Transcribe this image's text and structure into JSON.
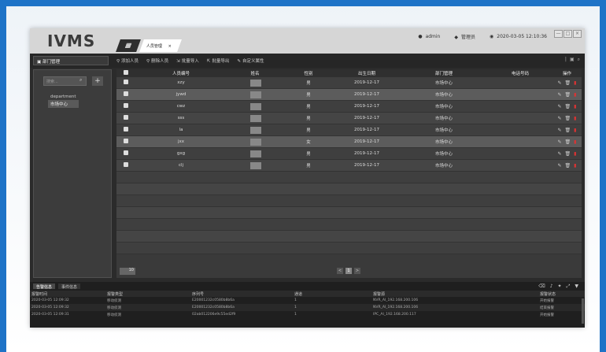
{
  "titlebar": {
    "logo": "IVMS",
    "home_tab_icon": "home-icon",
    "active_tab": "人员管理",
    "close_tab": "×",
    "user": "admin",
    "role": "管理员",
    "datetime": "2020-03-05 12:10:36",
    "window_buttons": [
      "—",
      "□",
      "×"
    ]
  },
  "toolbar": {
    "dept_title": "部门管理",
    "actions": [
      {
        "icon": "person-add-icon",
        "label": "添加人员"
      },
      {
        "icon": "person-remove-icon",
        "label": "删除人员"
      },
      {
        "icon": "import-icon",
        "label": "批量导入"
      },
      {
        "icon": "export-icon",
        "label": "批量导出"
      },
      {
        "icon": "edit-icon",
        "label": "自定义属性"
      }
    ]
  },
  "leftpanel": {
    "search_placeholder": "搜索...",
    "tree": [
      {
        "label": "department",
        "selected": false
      },
      {
        "label": "市场中心",
        "selected": true
      }
    ]
  },
  "table": {
    "headers": [
      "人员编号",
      "姓名",
      "性别",
      "出生日期",
      "部门管理",
      "电话号码",
      "操作"
    ],
    "rows": [
      {
        "id": "xzy",
        "name": "",
        "gender": "男",
        "birth": "2019-12-17",
        "dept": "市场中心",
        "phone": ""
      },
      {
        "id": "jywd",
        "name": "",
        "gender": "男",
        "birth": "2019-12-17",
        "dept": "市场中心",
        "phone": ""
      },
      {
        "id": "cwz",
        "name": "",
        "gender": "男",
        "birth": "2019-12-17",
        "dept": "市场中心",
        "phone": ""
      },
      {
        "id": "sss",
        "name": "",
        "gender": "男",
        "birth": "2019-12-17",
        "dept": "市场中心",
        "phone": ""
      },
      {
        "id": "la",
        "name": "",
        "gender": "男",
        "birth": "2019-12-17",
        "dept": "市场中心",
        "phone": ""
      },
      {
        "id": "jxx",
        "name": "",
        "gender": "女",
        "birth": "2019-12-17",
        "dept": "市场中心",
        "phone": ""
      },
      {
        "id": "gxg",
        "name": "",
        "gender": "男",
        "birth": "2019-12-17",
        "dept": "市场中心",
        "phone": ""
      },
      {
        "id": "clj",
        "name": "",
        "gender": "男",
        "birth": "2019-12-17",
        "dept": "市场中心",
        "phone": ""
      }
    ],
    "page_size": "10",
    "pager": {
      "prev": "<",
      "current": "1",
      "next": ">"
    }
  },
  "alarm": {
    "tabs": [
      "告警信息",
      "事件信息"
    ],
    "headers": [
      "报警时间",
      "报警类型",
      "序列号",
      "通道",
      "报警源",
      "",
      "报警状态"
    ],
    "rows": [
      {
        "time": "2020-03-05 12:09:32",
        "type": "移动侦测",
        "serial": "E20001232c0580b8b6a",
        "channel": "1",
        "source": "NVR_AI_192.168.200.106",
        "status": "开始报警"
      },
      {
        "time": "2020-03-05 12:09:32",
        "type": "移动侦测",
        "serial": "E20001232c0580b8b6a",
        "channel": "1",
        "source": "NVR_AI_192.168.200.106",
        "status": "结束报警"
      },
      {
        "time": "2020-03-05 12:09:31",
        "type": "移动侦测",
        "serial": "02ab012206e9c55ed2f9",
        "channel": "1",
        "source": "IPC_AI_192.168.200.117",
        "status": "开始报警"
      }
    ]
  }
}
